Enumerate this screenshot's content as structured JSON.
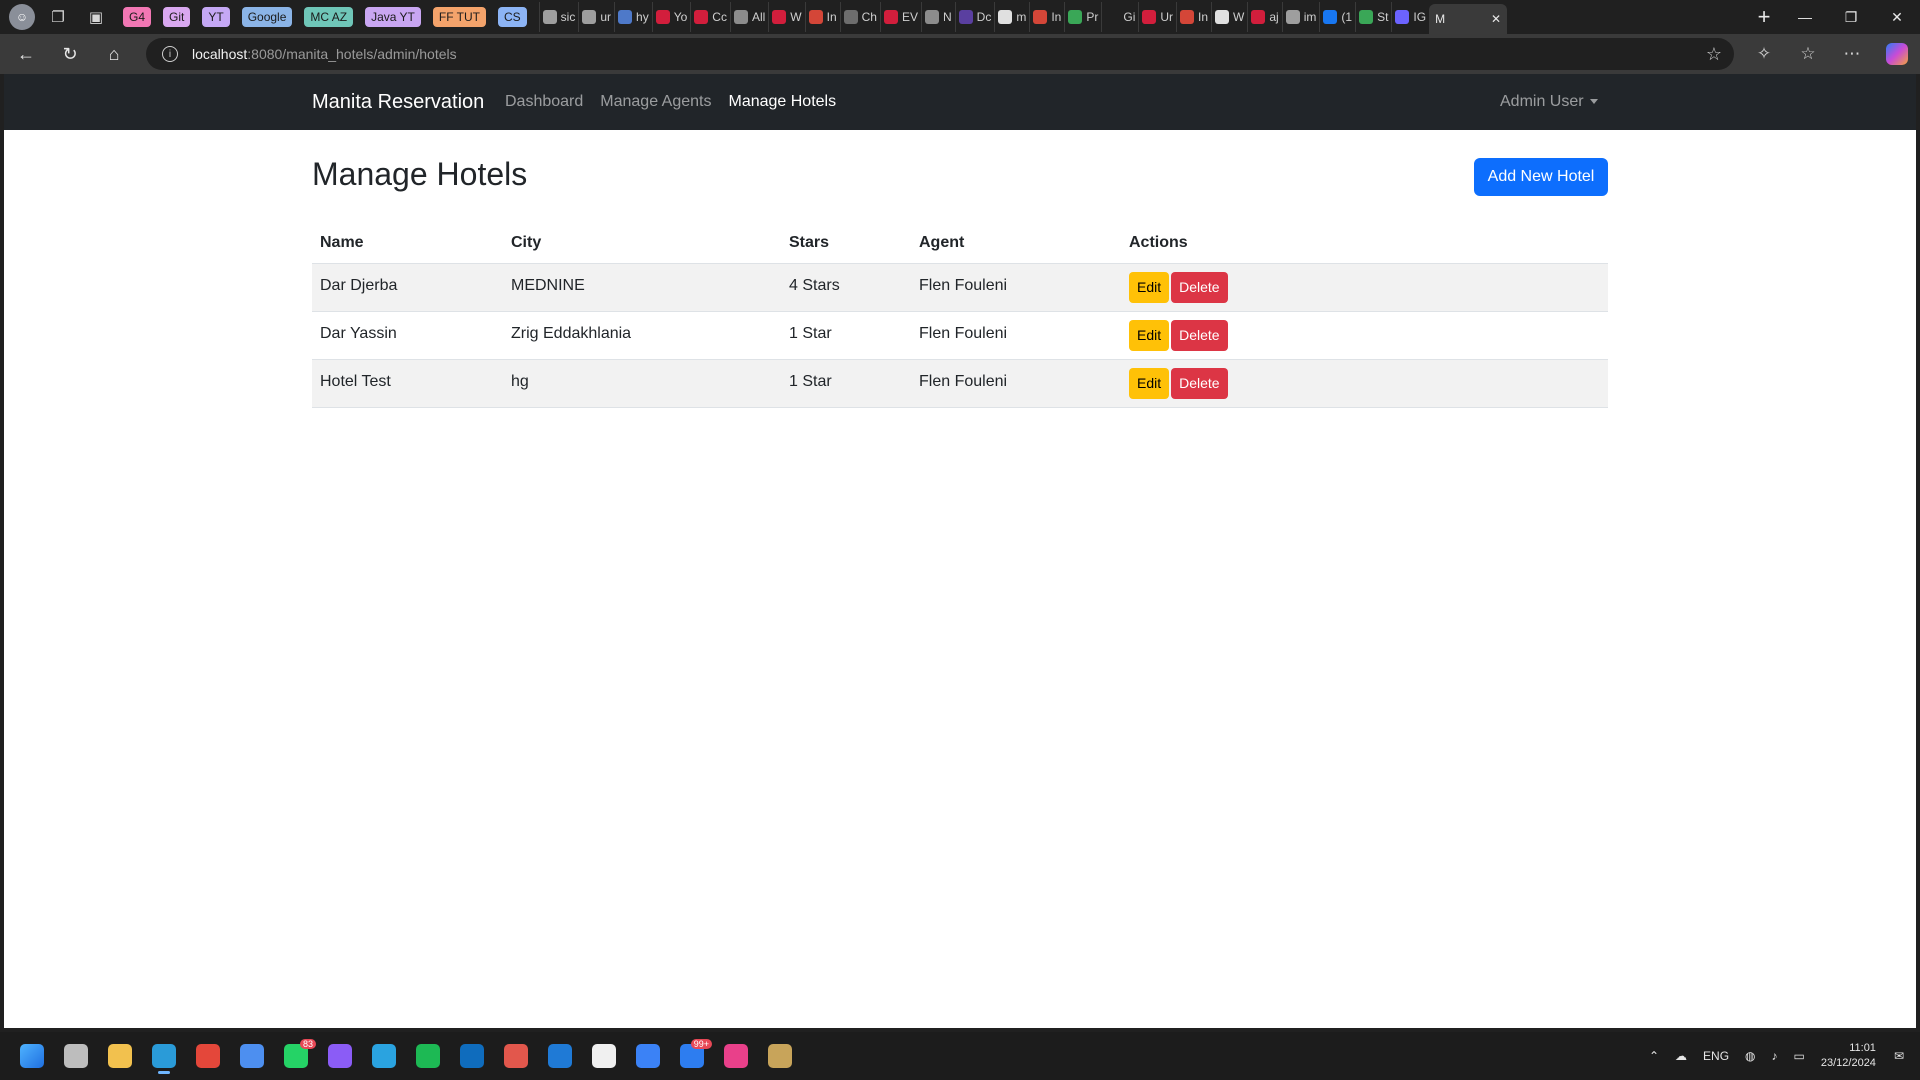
{
  "browser": {
    "tab_groups": [
      {
        "label": "G4",
        "color": "#f277b4"
      },
      {
        "label": "Git",
        "color": "#d9a8f0"
      },
      {
        "label": "YT",
        "color": "#c5a8f5"
      },
      {
        "label": "Google",
        "color": "#8bb4e7"
      },
      {
        "label": "MC AZ",
        "color": "#6fc6b8"
      },
      {
        "label": "Java YT",
        "color": "#c9a6f2"
      },
      {
        "label": "FF TUT",
        "color": "#f4a36b"
      },
      {
        "label": "CS",
        "color": "#8cb4f5"
      }
    ],
    "mini_tabs": [
      {
        "label": "sic",
        "color": "#9e9e9e"
      },
      {
        "label": "ur",
        "color": "#9e9e9e"
      },
      {
        "label": "hy",
        "color": "#4e79c9"
      },
      {
        "label": "Yo",
        "color": "#d21e3c"
      },
      {
        "label": "Cc",
        "color": "#d21e3c"
      },
      {
        "label": "All",
        "color": "#8c8c8c"
      },
      {
        "label": "W",
        "color": "#d21e3c"
      },
      {
        "label": "In",
        "color": "#d44638"
      },
      {
        "label": "Ch",
        "color": "#6d6d6d"
      },
      {
        "label": "EV",
        "color": "#d21e3c"
      },
      {
        "label": "N",
        "color": "#8c8c8c"
      },
      {
        "label": "Dc",
        "color": "#5a3fa0"
      },
      {
        "label": "m",
        "color": "#e0e0e0"
      },
      {
        "label": "In",
        "color": "#d44638"
      },
      {
        "label": "Pr",
        "color": "#3aa757"
      },
      {
        "label": "Gi",
        "color": "#202020"
      },
      {
        "label": "Ur",
        "color": "#d21e3c"
      },
      {
        "label": "In",
        "color": "#d44638"
      },
      {
        "label": "W",
        "color": "#e0e0e0"
      },
      {
        "label": "aj",
        "color": "#d21e3c"
      },
      {
        "label": "im",
        "color": "#9e9e9e"
      },
      {
        "label": "(1",
        "color": "#1877f2"
      },
      {
        "label": "St",
        "color": "#3aa757"
      },
      {
        "label": "IG",
        "color": "#6c63ff"
      }
    ],
    "active_tab": {
      "label": "M",
      "close": "✕"
    },
    "url_host": "localhost",
    "url_rest": ":8080/manita_hotels/admin/hotels"
  },
  "navbar": {
    "brand": "Manita Reservation",
    "links": [
      {
        "label": "Dashboard",
        "active": false
      },
      {
        "label": "Manage Agents",
        "active": false
      },
      {
        "label": "Manage Hotels",
        "active": true
      }
    ],
    "user": "Admin User"
  },
  "page": {
    "title": "Manage Hotels",
    "add_button": "Add New Hotel"
  },
  "table": {
    "headers": [
      "Name",
      "City",
      "Stars",
      "Agent",
      "Actions"
    ],
    "rows": [
      {
        "name": "Dar Djerba",
        "city": "MEDNINE",
        "stars": "4 Stars",
        "agent": "Flen Fouleni"
      },
      {
        "name": "Dar Yassin",
        "city": "Zrig Eddakhlania",
        "stars": "1 Star",
        "agent": "Flen Fouleni"
      },
      {
        "name": "Hotel Test",
        "city": "hg",
        "stars": "1 Star",
        "agent": "Flen Fouleni"
      }
    ],
    "edit_label": "Edit",
    "delete_label": "Delete"
  },
  "taskbar": {
    "apps": [
      {
        "name": "start",
        "color": "#3a8ee6"
      },
      {
        "name": "task-view",
        "color": "#bdbdbd"
      },
      {
        "name": "file-explorer",
        "color": "#f2c14e"
      },
      {
        "name": "edge",
        "color": "#2a9bd8"
      },
      {
        "name": "chrome",
        "color": "#e4473a"
      },
      {
        "name": "store",
        "color": "#4d8ff0"
      },
      {
        "name": "whatsapp",
        "color": "#25d366",
        "badge": "83"
      },
      {
        "name": "messenger",
        "color": "#8b5cf6"
      },
      {
        "name": "telegram",
        "color": "#2aa3e0"
      },
      {
        "name": "spotify",
        "color": "#1db954"
      },
      {
        "name": "outlook",
        "color": "#0f6cbd"
      },
      {
        "name": "app-red",
        "color": "#e2574c"
      },
      {
        "name": "trello",
        "color": "#1f7ad6"
      },
      {
        "name": "notion",
        "color": "#f0f0f0"
      },
      {
        "name": "notepad",
        "color": "#3b82f6"
      },
      {
        "name": "mail",
        "color": "#2d7df0",
        "badge": "99+"
      },
      {
        "name": "intellij",
        "color": "#e9408a"
      },
      {
        "name": "league",
        "color": "#c8a45a"
      }
    ],
    "tray": {
      "lang": "ENG",
      "time": "11:01",
      "date": "23/12/2024"
    }
  }
}
